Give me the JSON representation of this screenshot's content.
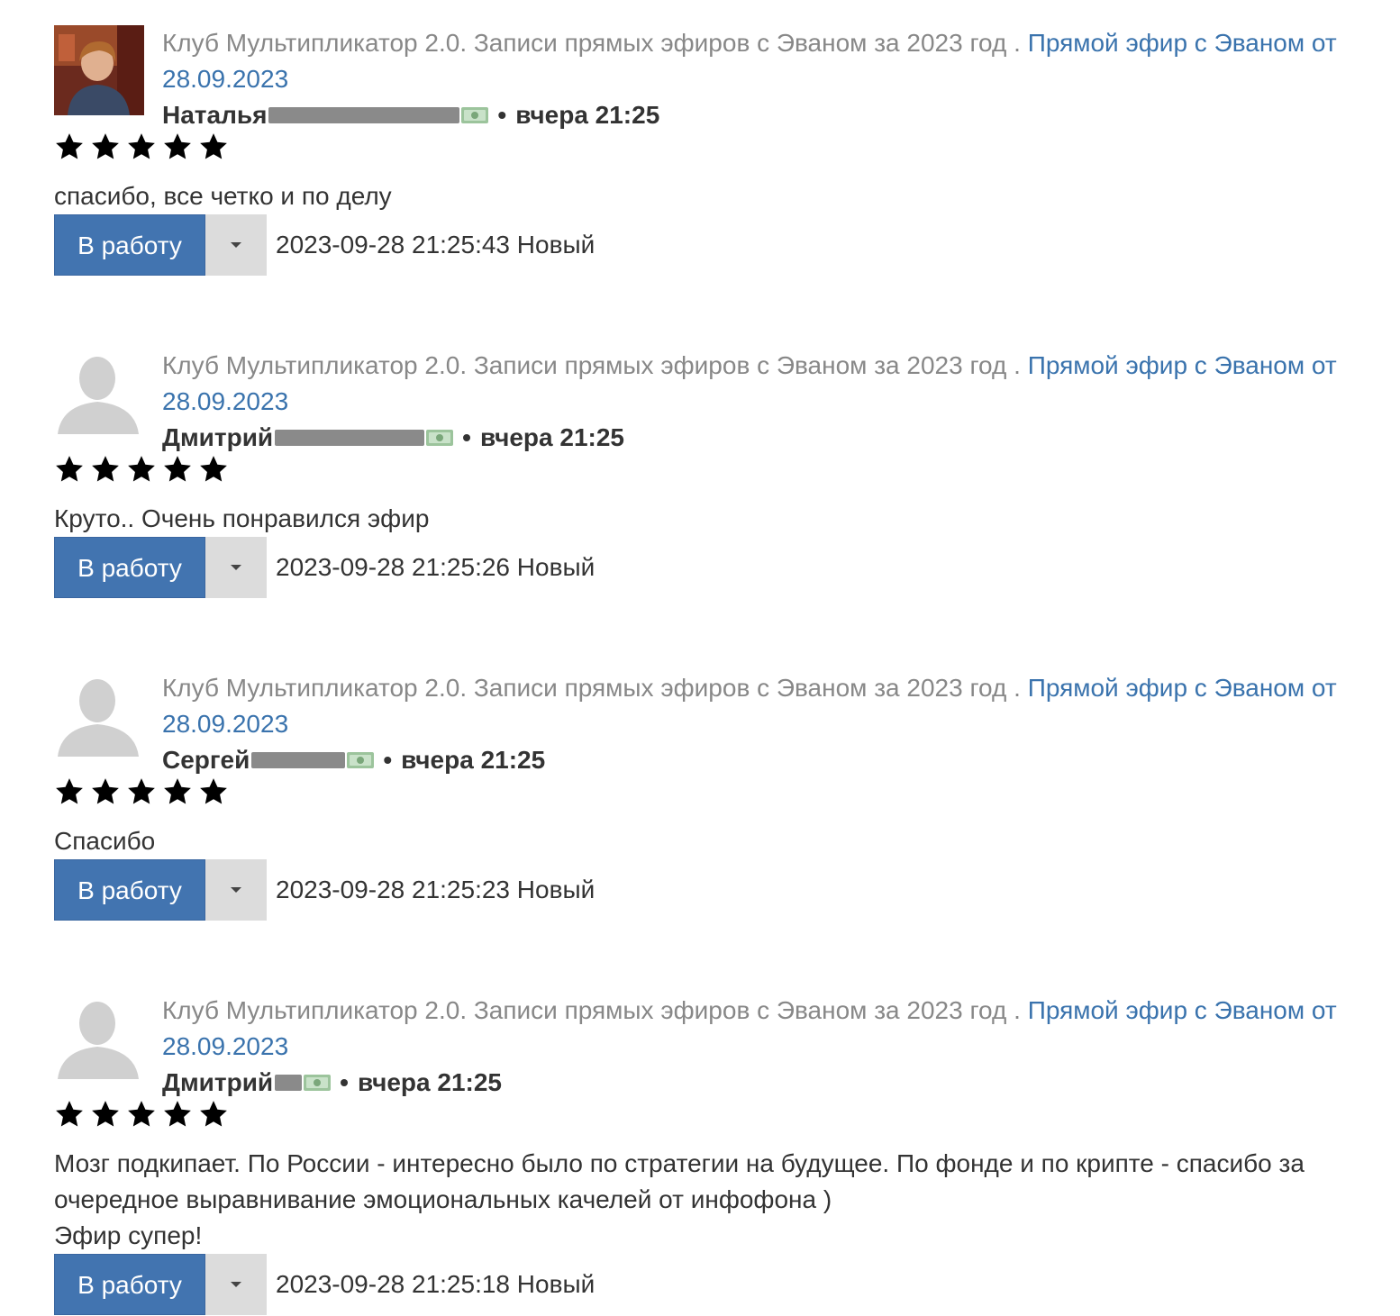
{
  "reviews": [
    {
      "course": "Клуб Мультипликатор 2.0. Записи прямых эфиров с Эваном за 2023 год .",
      "lesson_line1": "Прямой эфир с Эваном от",
      "lesson_line2": "28.09.2023",
      "author": "Наталья",
      "time": "вчера 21:25",
      "rating": 5,
      "comment": "спасибо, все четко и по делу",
      "button": "В работу",
      "timestamp": "2023-09-28 21:25:43",
      "status": "Новый",
      "avatar": "photo"
    },
    {
      "course": "Клуб Мультипликатор 2.0. Записи прямых эфиров с Эваном за 2023 год .",
      "lesson_line1": "Прямой эфир с Эваном от",
      "lesson_line2": "28.09.2023",
      "author": "Дмитрий",
      "time": "вчера 21:25",
      "rating": 5,
      "comment": "Круто.. Очень понравился эфир",
      "button": "В работу",
      "timestamp": "2023-09-28 21:25:26",
      "status": "Новый",
      "avatar": "placeholder"
    },
    {
      "course": "Клуб Мультипликатор 2.0. Записи прямых эфиров с Эваном за 2023 год .",
      "lesson_line1": "Прямой эфир с Эваном от",
      "lesson_line2": "28.09.2023",
      "author": "Сергей",
      "time": "вчера 21:25",
      "rating": 5,
      "comment": "Спасибо",
      "button": "В работу",
      "timestamp": "2023-09-28 21:25:23",
      "status": "Новый",
      "avatar": "placeholder"
    },
    {
      "course": "Клуб Мультипликатор 2.0. Записи прямых эфиров с Эваном за 2023 год .",
      "lesson_line1": "Прямой эфир с Эваном от",
      "lesson_line2": "28.09.2023",
      "author": "Дмитрий",
      "time": "вчера 21:25",
      "rating": 5,
      "comment": "Мозг подкипает. По России - интересно было по стратегии на будущее. По фонде и по крипте - спасибо за\nочередное выравнивание эмоциональных качелей от инфофона )\nЭфир супер!",
      "button": "В работу",
      "timestamp": "2023-09-28 21:25:18",
      "status": "Новый",
      "avatar": "placeholder"
    }
  ],
  "icons": {
    "star": "star-icon",
    "money": "money-icon",
    "dropdown": "caret-down-icon"
  },
  "colors": {
    "button_blue": "#4274b0",
    "link_blue": "#3a73ad",
    "muted_gray": "#888888",
    "money_green": "#9cc49c"
  }
}
